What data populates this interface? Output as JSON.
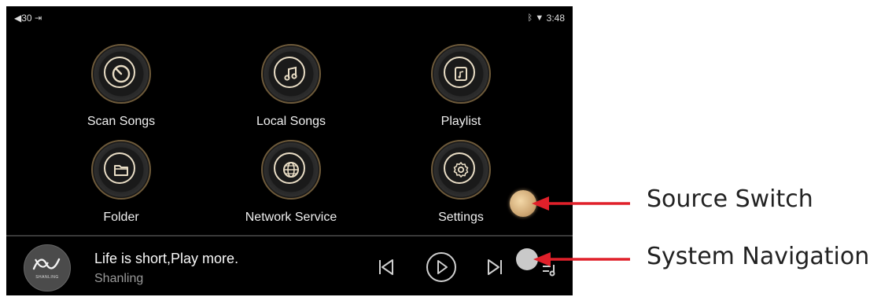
{
  "status": {
    "volume": "30",
    "time": "3:48"
  },
  "apps": [
    {
      "label": "Scan Songs",
      "icon": "scan-icon"
    },
    {
      "label": "Local Songs",
      "icon": "music-note-icon"
    },
    {
      "label": "Playlist",
      "icon": "playlist-icon"
    },
    {
      "label": "Folder",
      "icon": "folder-icon"
    },
    {
      "label": "Network Service",
      "icon": "globe-icon"
    },
    {
      "label": "Settings",
      "icon": "gear-icon"
    }
  ],
  "player": {
    "title": "Life is short,Play more.",
    "artist": "Shanling",
    "album_brand": "SHANLING"
  },
  "annotations": {
    "source_switch": "Source Switch",
    "system_navigation": "System Navigation"
  },
  "colors": {
    "screen_bg": "#000000",
    "accent_gold": "#cfa874",
    "arrow_red": "#e0202a"
  }
}
